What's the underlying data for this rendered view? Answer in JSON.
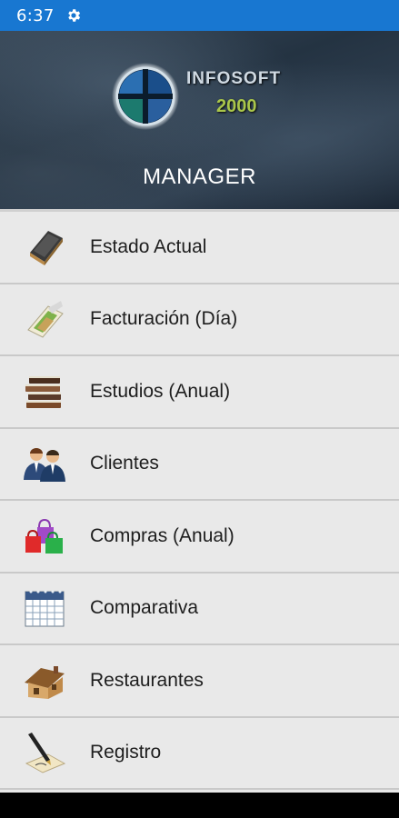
{
  "status_bar": {
    "time": "6:37",
    "settings_icon": "gear-icon"
  },
  "header": {
    "logo": {
      "line1": "INFOSOFT",
      "line2": "2000",
      "icon": "globe-logo-icon"
    },
    "title": "MANAGER"
  },
  "menu": {
    "items": [
      {
        "label": "Estado Actual",
        "icon": "notebook-icon"
      },
      {
        "label": "Facturación (Día)",
        "icon": "invoice-icon"
      },
      {
        "label": "Estudios (Anual)",
        "icon": "book-stack-icon"
      },
      {
        "label": "Clientes",
        "icon": "users-icon"
      },
      {
        "label": "Compras (Anual)",
        "icon": "shopping-bags-icon"
      },
      {
        "label": "Comparativa",
        "icon": "calendar-icon"
      },
      {
        "label": "Restaurantes",
        "icon": "house-icon"
      },
      {
        "label": "Registro",
        "icon": "pen-paper-icon"
      }
    ]
  },
  "colors": {
    "status_bar": "#1877d1",
    "menu_bg": "#e9e9e9",
    "logo_green": "#a9c54a"
  }
}
